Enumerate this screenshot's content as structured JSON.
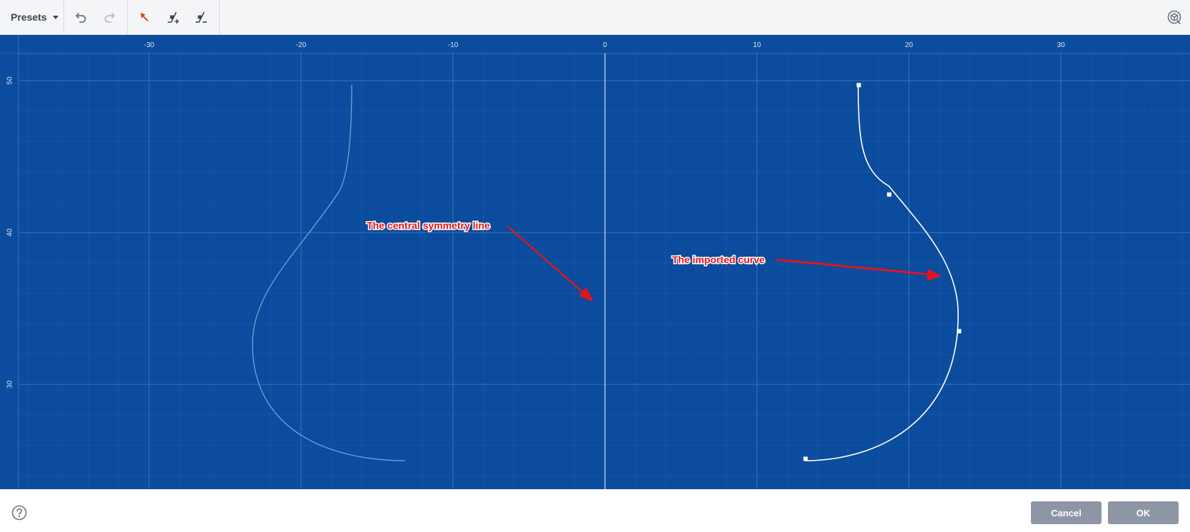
{
  "toolbar": {
    "presets_label": "Presets",
    "icons": [
      "undo-icon",
      "redo-icon",
      "select-arrow-icon",
      "add-point-icon",
      "remove-point-icon",
      "view-toggle-icon"
    ]
  },
  "canvas": {
    "x_ticks": [
      "-30",
      "-20",
      "-10",
      "0",
      "10",
      "20",
      "30"
    ],
    "y_ticks": [
      "50",
      "40",
      "30"
    ],
    "x_values": [
      -30,
      -20,
      -10,
      0,
      10,
      20,
      30
    ],
    "y_values": [
      50,
      40,
      30
    ],
    "annotations": {
      "symmetry": "The central symmetry line",
      "curve": "The imported curve"
    },
    "colors": {
      "background": "#0b4c9e",
      "grid": "#3d72b8",
      "curve": "#ffffff",
      "annotation": "#e4141b"
    },
    "control_points": [
      {
        "x": 16.7,
        "y": 49.7
      },
      {
        "x": 18.7,
        "y": 42.5
      },
      {
        "x": 23.3,
        "y": 33.5
      },
      {
        "x": 13.2,
        "y": 25.1
      }
    ]
  },
  "footer": {
    "cancel_label": "Cancel",
    "ok_label": "OK"
  }
}
